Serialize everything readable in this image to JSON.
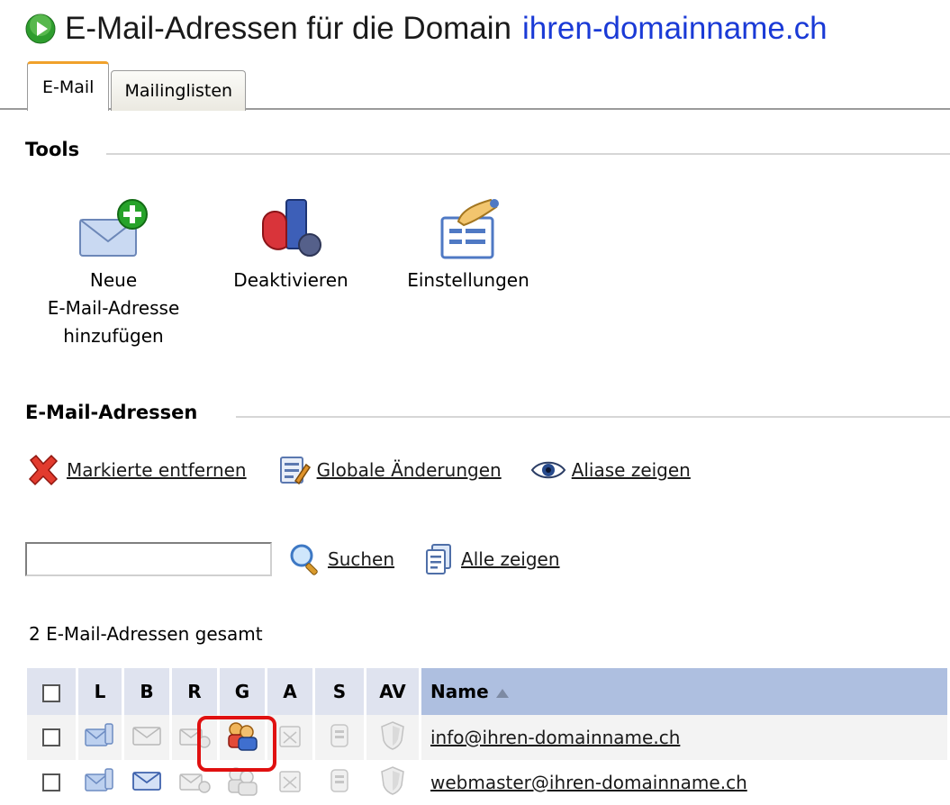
{
  "header": {
    "title": "E-Mail-Adressen für die Domain",
    "domain": "ihren-domainname.ch",
    "icon": "go-arrow-icon"
  },
  "tabs": [
    {
      "label": "E-Mail",
      "active": true
    },
    {
      "label": "Mailinglisten",
      "active": false
    }
  ],
  "tools_section": {
    "title": "Tools",
    "items": [
      {
        "lines": [
          "Neue",
          "E-Mail-Adresse",
          "hinzufügen"
        ],
        "icon": "mail-add-icon"
      },
      {
        "lines": [
          "Deaktivieren"
        ],
        "icon": "deactivate-icon"
      },
      {
        "lines": [
          "Einstellungen"
        ],
        "icon": "settings-icon"
      }
    ]
  },
  "addresses_section": {
    "title": "E-Mail-Adressen",
    "actions": [
      {
        "label": "Markierte entfernen",
        "icon": "delete-x-icon"
      },
      {
        "label": "Globale Änderungen",
        "icon": "global-edit-icon"
      },
      {
        "label": "Aliase zeigen",
        "icon": "eye-icon"
      }
    ],
    "search": {
      "value": "",
      "placeholder": "",
      "search_label": "Suchen",
      "show_all_label": "Alle zeigen"
    },
    "count_text": "2 E-Mail-Adressen gesamt",
    "table": {
      "columns": [
        "L",
        "B",
        "R",
        "G",
        "A",
        "S",
        "AV",
        "Name"
      ],
      "sort_column": "Name",
      "sort_direction": "ascending",
      "rows": [
        {
          "name": "info@ihren-domainname.ch"
        },
        {
          "name": "webmaster@ihren-domainname.ch"
        }
      ]
    }
  },
  "colors": {
    "domain_link": "#1a3ad6",
    "tab_accent": "#f0a12b",
    "header_bg": "#dfe3ef",
    "name_header_bg": "#aebfe0",
    "highlight": "#e01010"
  }
}
